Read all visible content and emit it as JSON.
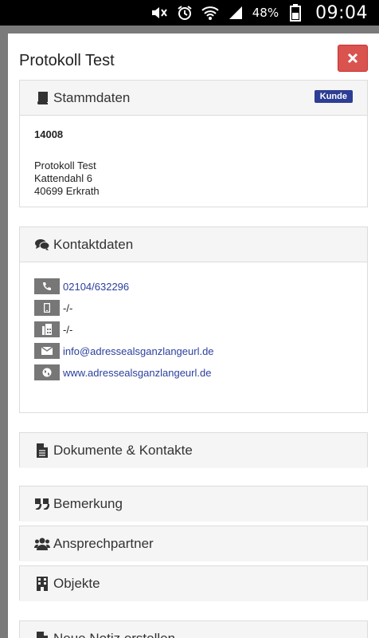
{
  "statusbar": {
    "battery": "48%",
    "time": "09:04",
    "icons": [
      "mute-icon",
      "alarm-icon",
      "wifi-icon",
      "signal-icon",
      "battery-icon"
    ]
  },
  "modal": {
    "title": "Protokoll Test",
    "close_icon": "close-icon"
  },
  "stammdaten": {
    "heading": "Stammdaten",
    "icon": "book-icon",
    "badge": "Kunde",
    "customer_number": "14008",
    "address": [
      "Protokoll Test",
      "Kattendahl 6",
      "40699 Erkrath"
    ]
  },
  "kontaktdaten": {
    "heading": "Kontaktdaten",
    "icon": "comments-icon",
    "rows": [
      {
        "icon": "phone-icon",
        "value": "02104/632296",
        "link": true
      },
      {
        "icon": "mobile-icon",
        "value": "-/-",
        "link": false
      },
      {
        "icon": "fax-icon",
        "value": "-/-",
        "link": false
      },
      {
        "icon": "envelope-icon",
        "value": "info@adressealsganzlangeurl.de",
        "link": true
      },
      {
        "icon": "globe-icon",
        "value": "www.adressealsganzlangeurl.de",
        "link": true
      }
    ]
  },
  "sections": [
    {
      "heading": "Dokumente & Kontakte",
      "icon": "document-icon"
    },
    {
      "heading": "Bemerkung",
      "icon": "quote-icon"
    },
    {
      "heading": "Ansprechpartner",
      "icon": "users-icon"
    },
    {
      "heading": "Objekte",
      "icon": "building-icon"
    },
    {
      "heading": "Neue Notiz erstellen",
      "icon": "document-icon"
    }
  ],
  "colors": {
    "danger": "#d9534f",
    "badge": "#2d3e94",
    "link": "#2a3f9d",
    "panel_heading_bg": "#f5f5f5"
  }
}
